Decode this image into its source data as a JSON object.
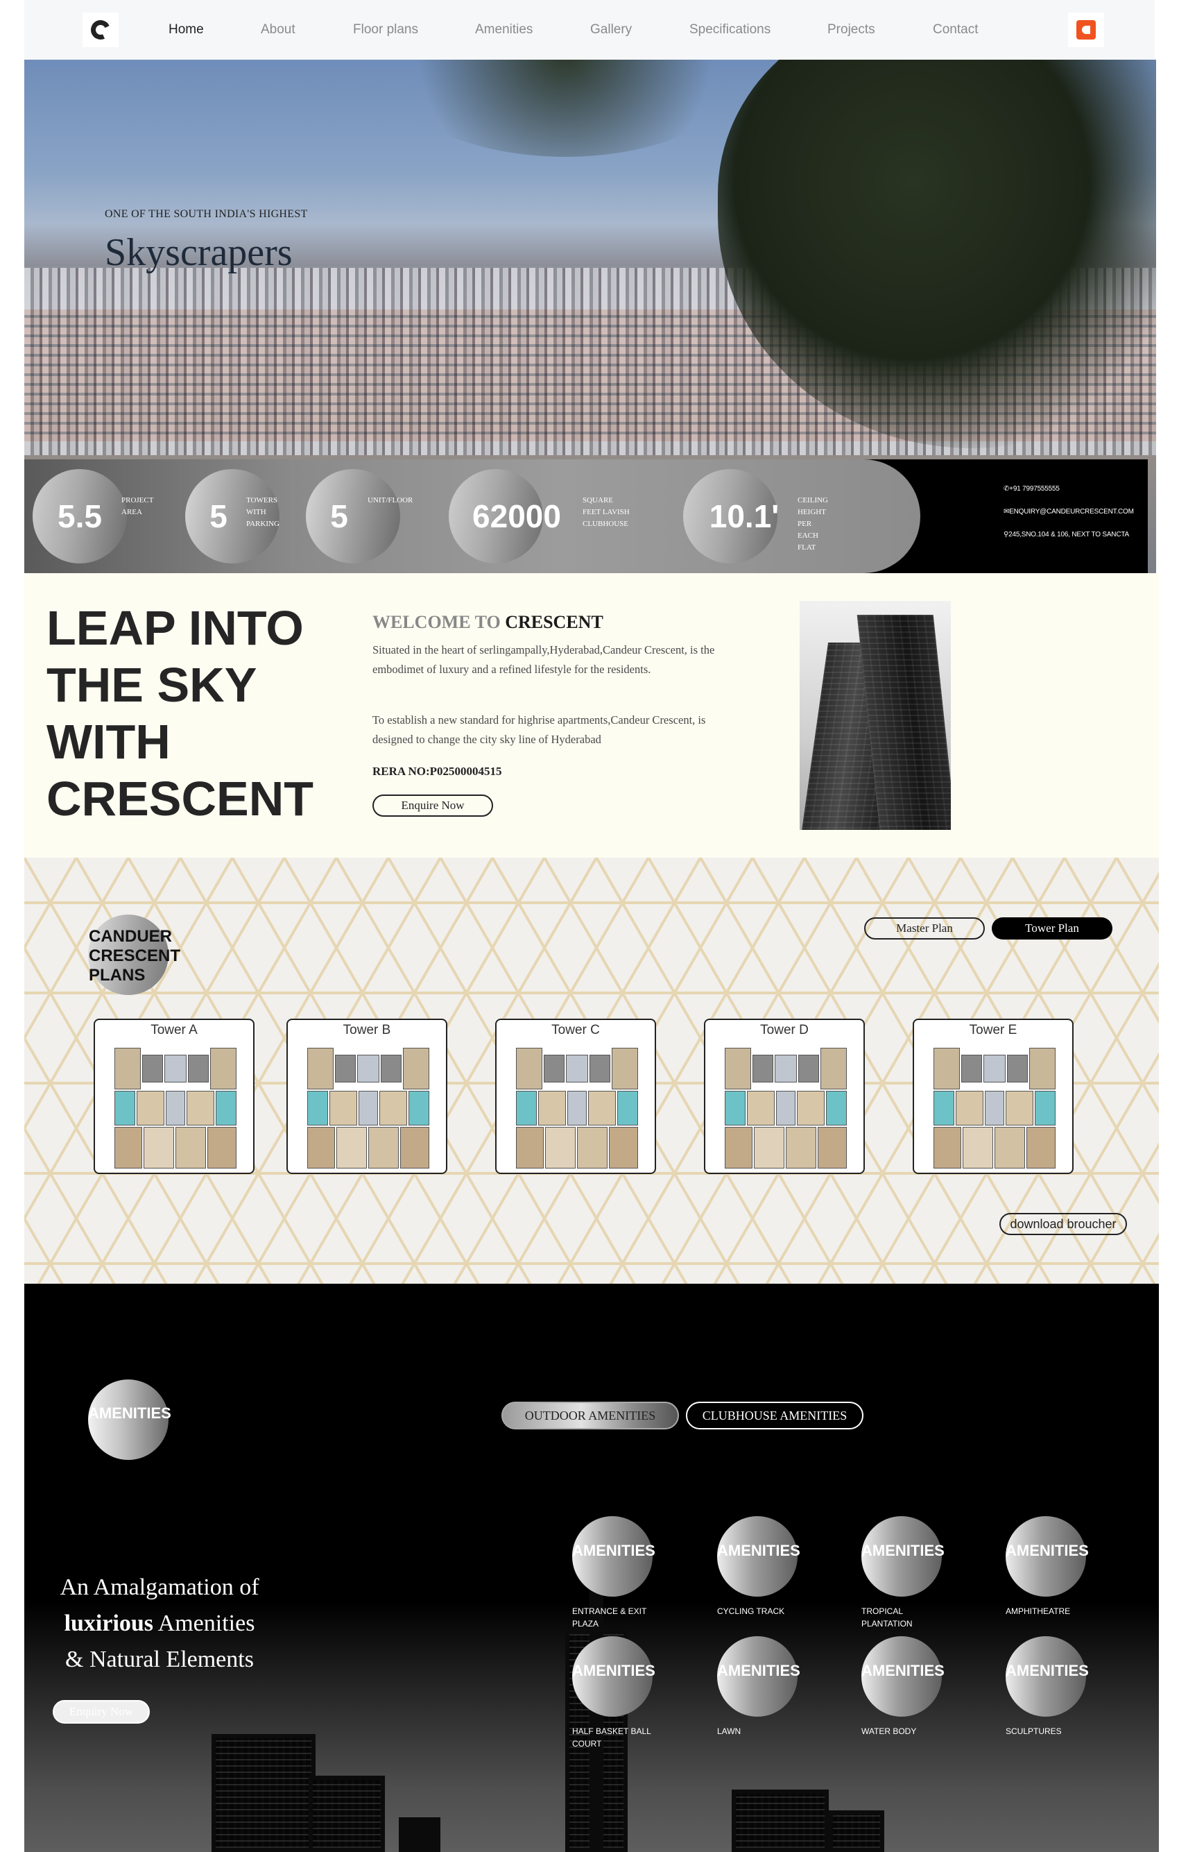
{
  "nav": {
    "items": [
      "Home",
      "About",
      "Floor plans",
      "Amenities",
      "Gallery",
      "Specifications",
      "Projects",
      "Contact"
    ],
    "active": "Home"
  },
  "hero": {
    "subtitle": "ONE OF THE SOUTH INDIA'S HIGHEST",
    "title": "Skyscrapers"
  },
  "stats": [
    {
      "value": "5.5",
      "label": "PROJECT AREA"
    },
    {
      "value": "5",
      "label": "TOWERS WITH PARKING"
    },
    {
      "value": "5",
      "label": "UNIT/FLOOR"
    },
    {
      "value": "62000",
      "label": "SQUARE FEET LAVISH CLUBHOUSE"
    },
    {
      "value": "10.1'",
      "label": "CEILING HEIGHT PER EACH FLAT"
    }
  ],
  "contact": {
    "phone": "✆+91 7997555555",
    "email": "✉ENQUIRY@CANDEURCRESCENT.COM",
    "address": "⚲245,SNO.104 & 106, NEXT TO SANCTA"
  },
  "welcome": {
    "headline": "LEAP INTO THE SKY WITH CRESCENT",
    "title_prefix": "WELCOME TO",
    "title_brand": "CRESCENT",
    "para1": "Situated in the heart of serlingampally,Hyderabad,Candeur Crescent, is the embodimet of luxury and a refined lifestyle for the residents.",
    "para2": "To establish a new standard for highrise apartments,Candeur Crescent, is designed to change the city sky line of Hyderabad",
    "rera": "RERA NO:P02500004515",
    "button": "Enquire Now"
  },
  "plans": {
    "title": "CANDUER CRESCENT PLANS",
    "toggle_master": "Master Plan",
    "toggle_tower": "Tower Plan",
    "towers": [
      "Tower A",
      "Tower B",
      "Tower C",
      "Tower D",
      "Tower E"
    ],
    "download": "download broucher"
  },
  "amenities": {
    "title": "AMENITIES",
    "tab_outdoor": "OUTDOOR AMENITIES",
    "tab_clubhouse": "CLUBHOUSE AMENITIES",
    "heading_line1": "An Amalgamation of",
    "heading_bold": "luxirious",
    "heading_line2_rest": " Amenities",
    "heading_line3": "& Natural Elements",
    "button": "Enquiry Now",
    "circle_text": "AMENITIES",
    "items": [
      "ENTRANCE & EXIT PLAZA",
      "CYCLING TRACK",
      "TROPICAL PLANTATION",
      "AMPHITHEATRE",
      "HALF BASKET BALL COURT",
      "LAWN",
      "WATER BODY",
      "SCULPTURES"
    ]
  },
  "colors": {
    "brand_orange": "#f0531f",
    "cream_bg": "#fdfdf2",
    "plans_bg": "#f1f0ed",
    "lattice": "#e6d6b2"
  }
}
